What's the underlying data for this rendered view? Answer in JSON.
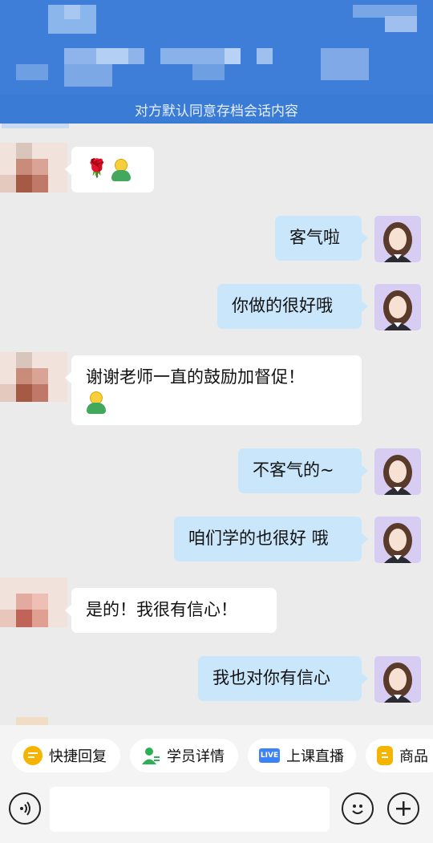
{
  "banner": {
    "text": "对方默认同意存档会话内容"
  },
  "messages": [
    {
      "side": "left",
      "text": "🌹",
      "kind": "emoji"
    },
    {
      "side": "right",
      "text": "客气啦"
    },
    {
      "side": "right",
      "text": "你做的很好哦"
    },
    {
      "side": "left",
      "text": "谢谢老师一直的鼓励加督促！"
    },
    {
      "side": "right",
      "text": "不客气的~"
    },
    {
      "side": "right",
      "text": "咱们学的也很好 哦"
    },
    {
      "side": "left",
      "text": "是的！我很有信心！"
    },
    {
      "side": "right",
      "text": "我也对你有信心"
    }
  ],
  "quick_actions": [
    {
      "label": "快捷回复",
      "icon": "quick-reply-icon",
      "color": "#f5b400"
    },
    {
      "label": "学员详情",
      "icon": "student-detail-icon",
      "color": "#2eae57"
    },
    {
      "label": "上课直播",
      "icon": "live-icon",
      "color": "#3e82f7",
      "badge": "LIVE"
    },
    {
      "label": "商品",
      "icon": "product-icon",
      "color": "#f5b400"
    }
  ],
  "icons": {
    "voice": "voice-icon",
    "emoji": "emoji-icon",
    "plus": "plus-icon"
  },
  "colors": {
    "header": "#3f7ed8",
    "bubble_right": "#c9e6fb",
    "bubble_left": "#ffffff"
  }
}
